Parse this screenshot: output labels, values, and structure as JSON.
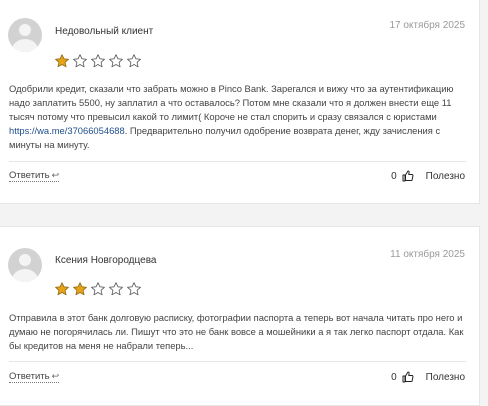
{
  "reviews": [
    {
      "author": "Недовольный клиент",
      "date": "17 октября 2025",
      "rating": 1,
      "text_before_link": "Одобрили кредит, сказали что забрать можно в Pinco Bank. Зарегался и вижу что за аутентификацию надо заплатить 5500, ну заплатил а что оставалось? Потом мне сказали что я должен внести еще 11 тысяч потому что превысил какой то лимит( Короче не стал спорить и сразу связался с юристами ",
      "link": "https://wa.me/37066054688",
      "text_after_link": ". Предварительно получил одобрение возврата денег, жду зачисления с минуты на минуту.",
      "reply_label": "Ответить",
      "likes": "0",
      "useful_label": "Полезно"
    },
    {
      "author": "Ксения Новгородцева",
      "date": "11 октября 2025",
      "rating": 2,
      "text": "Отправила в этот банк долговую расписку, фотографии паспорта а теперь вот начала читать про него и думаю не погорячилась ли. Пишут что это не банк вовсе а мошейники а я так легко паспорт отдала. Как бы кредитов на меня не набрали теперь...",
      "reply_label": "Ответить",
      "likes": "0",
      "useful_label": "Полезно"
    }
  ],
  "colors": {
    "star_filled": "#e8a317",
    "star_empty": "#c9c9c9",
    "link": "#1f4e8c"
  },
  "icons": [
    "avatar-placeholder",
    "star-icon",
    "reply-arrow-icon",
    "thumbs-up-icon"
  ]
}
